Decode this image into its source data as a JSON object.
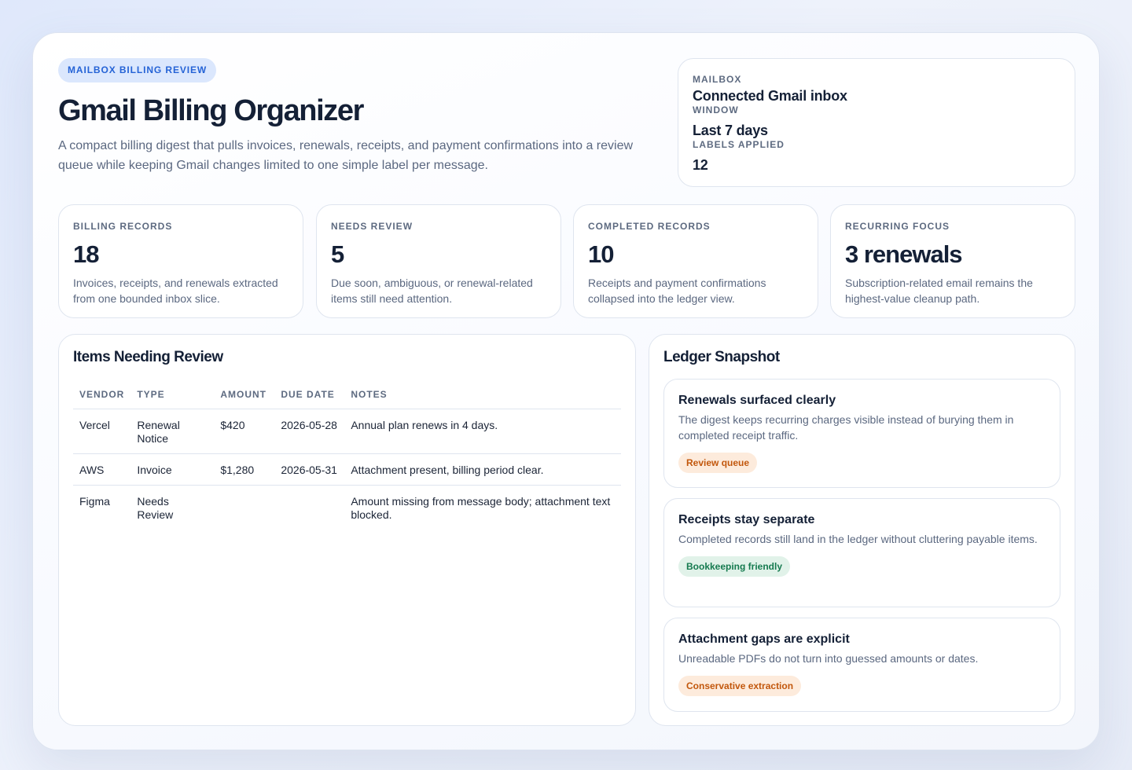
{
  "header": {
    "eyebrow": "MAILBOX BILLING REVIEW",
    "title": "Gmail Billing Organizer",
    "subtitle": "A compact billing digest that pulls invoices, renewals, receipts, and payment confirmations into a review queue while keeping Gmail changes limited to one simple label per message."
  },
  "meta": {
    "mailbox_label": "MAILBOX",
    "mailbox_value": "Connected Gmail inbox",
    "window_label": "WINDOW",
    "window_value": "Last 7 days",
    "labels_label": "LABELS APPLIED",
    "labels_value": "12"
  },
  "stats": [
    {
      "label": "BILLING RECORDS",
      "value": "18",
      "desc": "Invoices, receipts, and renewals extracted from one bounded inbox slice."
    },
    {
      "label": "NEEDS REVIEW",
      "value": "5",
      "desc": "Due soon, ambiguous, or renewal-related items still need attention."
    },
    {
      "label": "COMPLETED RECORDS",
      "value": "10",
      "desc": "Receipts and payment confirmations collapsed into the ledger view."
    },
    {
      "label": "RECURRING FOCUS",
      "value": "3 renewals",
      "desc": "Subscription-related email remains the highest-value cleanup path."
    }
  ],
  "review": {
    "title": "Items Needing Review",
    "columns": [
      "VENDOR",
      "TYPE",
      "AMOUNT",
      "DUE DATE",
      "NOTES"
    ],
    "rows": [
      {
        "vendor": "Vercel",
        "type": "Renewal Notice",
        "amount": "$420",
        "due": "2026-05-28",
        "notes": "Annual plan renews in 4 days."
      },
      {
        "vendor": "AWS",
        "type": "Invoice",
        "amount": "$1,280",
        "due": "2026-05-31",
        "notes": "Attachment present, billing period clear."
      },
      {
        "vendor": "Figma",
        "type": "Needs Review",
        "amount": "",
        "due": "",
        "notes": "Amount missing from message body; attachment text blocked."
      }
    ]
  },
  "ledger": {
    "title": "Ledger Snapshot",
    "cards": [
      {
        "title": "Renewals surfaced clearly",
        "desc": "The digest keeps recurring charges visible instead of burying them in completed receipt traffic.",
        "tag": "Review queue",
        "tag_color": "#c2570c",
        "tag_bg": "#fdebdc"
      },
      {
        "title": "Receipts stay separate",
        "desc": "Completed records still land in the ledger without cluttering payable items.",
        "tag": "Bookkeeping friendly",
        "tag_color": "#157a4f",
        "tag_bg": "#e1f2e9"
      },
      {
        "title": "Attachment gaps are explicit",
        "desc": "Unreadable PDFs do not turn into guessed amounts or dates.",
        "tag": "Conservative extraction",
        "tag_color": "#c2570c",
        "tag_bg": "#fdebdc"
      }
    ]
  }
}
